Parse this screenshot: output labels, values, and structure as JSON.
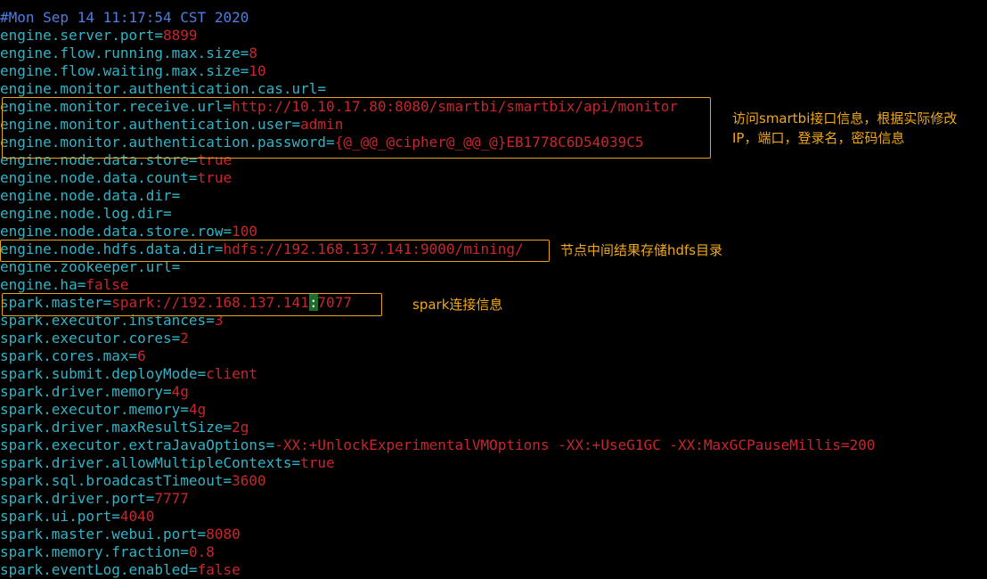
{
  "header_comment": "#Mon Sep 14 11:17:54 CST 2020",
  "lines": [
    {
      "key": "engine.server.port",
      "value": "8899"
    },
    {
      "key": "engine.flow.running.max.size",
      "value": "8"
    },
    {
      "key": "engine.flow.waiting.max.size",
      "value": "10"
    },
    {
      "key": "engine.monitor.authentication.cas.url",
      "value": ""
    },
    {
      "key": "engine.monitor.receive.url",
      "value": "http://10.10.17.80:8080/smartbi/smartbix/api/monitor"
    },
    {
      "key": "engine.monitor.authentication.user",
      "value": "admin"
    },
    {
      "key": "engine.monitor.authentication.password",
      "value": "{@_@@_@cipher@_@@_@}EB1778C6D54039C5"
    },
    {
      "key": "engine.node.data.store",
      "value": "true"
    },
    {
      "key": "engine.node.data.count",
      "value": "true"
    },
    {
      "key": "engine.node.data.dir",
      "value": ""
    },
    {
      "key": "engine.node.log.dir",
      "value": ""
    },
    {
      "key": "engine.node.data.store.row",
      "value": "100"
    },
    {
      "key": "engine.node.hdfs.data.dir",
      "value": "hdfs://192.168.137.141:9000/mining/"
    },
    {
      "key": "engine.zookeeper.url",
      "value": ""
    },
    {
      "key": "engine.ha",
      "value": "false"
    },
    {
      "key": "spark.master",
      "value": "spark://192.168.137.141:7077"
    },
    {
      "key": "spark.executor.instances",
      "value": "3"
    },
    {
      "key": "spark.executor.cores",
      "value": "2"
    },
    {
      "key": "spark.cores.max",
      "value": "6"
    },
    {
      "key": "spark.submit.deployMode",
      "value": "client"
    },
    {
      "key": "spark.driver.memory",
      "value": "4g"
    },
    {
      "key": "spark.executor.memory",
      "value": "4g"
    },
    {
      "key": "spark.driver.maxResultSize",
      "value": "2g"
    },
    {
      "key": "spark.executor.extraJavaOptions",
      "value": "-XX:+UnlockExperimentalVMOptions -XX:+UseG1GC -XX:MaxGCPauseMillis=200"
    },
    {
      "key": "spark.driver.allowMultipleContexts",
      "value": "true"
    },
    {
      "key": "spark.sql.broadcastTimeout",
      "value": "3600"
    },
    {
      "key": "spark.driver.port",
      "value": "7777"
    },
    {
      "key": "spark.ui.port",
      "value": "4040"
    },
    {
      "key": "spark.master.webui.port",
      "value": "8080"
    },
    {
      "key": "spark.memory.fraction",
      "value": "0.8"
    },
    {
      "key": "spark.eventLog.enabled",
      "value": "false"
    }
  ],
  "annotations": {
    "monitor_note_line1": "访问smartbi接口信息，根据实际修改",
    "monitor_note_line2": "IP，端口，登录名，密码信息",
    "hdfs_note": "节点中间结果存储hdfs目录",
    "spark_note": "spark连接信息"
  },
  "colors": {
    "background": "#000000",
    "key": "#33b3c6",
    "value": "#c8262d",
    "comment": "#4f7de3",
    "annotation": "#f0a818",
    "cursor": "#1b6f2a"
  }
}
